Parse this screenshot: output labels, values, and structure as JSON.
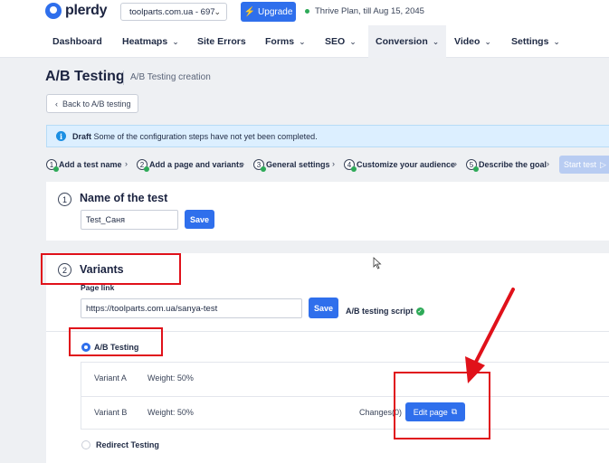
{
  "header": {
    "logo_text": "plerdy",
    "site_select": "toolparts.com.ua - 697",
    "upgrade_label": "Upgrade",
    "plan_text": "Thrive Plan, till Aug 15, 2045"
  },
  "nav": {
    "items": [
      {
        "label": "Dashboard",
        "dropdown": false
      },
      {
        "label": "Heatmaps",
        "dropdown": true
      },
      {
        "label": "Site Errors",
        "dropdown": false
      },
      {
        "label": "Forms",
        "dropdown": true
      },
      {
        "label": "SEO",
        "dropdown": true
      },
      {
        "label": "Conversion",
        "dropdown": true,
        "active": true
      },
      {
        "label": "Video",
        "dropdown": true
      },
      {
        "label": "Settings",
        "dropdown": true
      }
    ]
  },
  "page": {
    "title": "A/B Testing",
    "subtitle": "A/B Testing creation",
    "back_label": "Back to A/B testing"
  },
  "alert": {
    "strong": "Draft",
    "text": "Some of the configuration steps have not yet been completed."
  },
  "steps": [
    {
      "num": "1",
      "label": "Add a test name"
    },
    {
      "num": "2",
      "label": "Add a page and variants"
    },
    {
      "num": "3",
      "label": "General settings"
    },
    {
      "num": "4",
      "label": "Customize your audience"
    },
    {
      "num": "5",
      "label": "Describe the goal"
    }
  ],
  "start_test_label": "Start test",
  "section1": {
    "num": "1",
    "title": "Name of the test",
    "input_value": "Test_Саня",
    "save_label": "Save"
  },
  "section2": {
    "num": "2",
    "title": "Variants",
    "page_link_label": "Page link",
    "page_link_value": "https://toolparts.com.ua/sanya-test",
    "save_label": "Save",
    "script_label": "A/B testing script",
    "ab_option": "A/B Testing",
    "redirect_option": "Redirect Testing",
    "variants": [
      {
        "name": "Variant A",
        "weight": "Weight: 50%"
      },
      {
        "name": "Variant B",
        "weight": "Weight: 50%",
        "changes": "Changes(0)",
        "edit_label": "Edit page"
      }
    ]
  },
  "colors": {
    "primary": "#2f6fec",
    "success": "#2eaa58",
    "annotation": "#e0111a",
    "alert_bg": "#dcefff"
  }
}
